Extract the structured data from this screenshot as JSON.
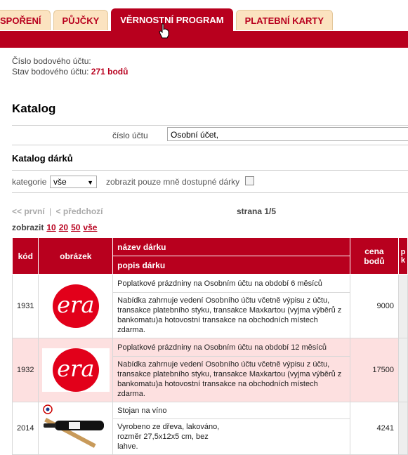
{
  "tabs": [
    "SPOŘENÍ",
    "PŮJČKY",
    "VĚRNOSTNÍ PROGRAM",
    "PLATEBNÍ KARTY"
  ],
  "account": {
    "number_label": "Číslo bodového účtu:",
    "balance_label": "Stav bodového účtu:",
    "balance_value": "271 bodů"
  },
  "catalog": {
    "title": "Katalog",
    "account_label": "číslo účtu",
    "account_value": "Osobní účet,",
    "gifts_title": "Katalog dárků",
    "category_label": "kategorie",
    "category_value": "vše",
    "only_available_label": "zobrazit pouze mně dostupné dárky"
  },
  "pager": {
    "first": "<< první",
    "sep": "|",
    "prev": "< předchozí",
    "page_info": "strana 1/5",
    "show_label": "zobrazit",
    "show_options": [
      "10",
      "20",
      "50",
      "vše"
    ]
  },
  "table": {
    "headers": {
      "code": "kód",
      "image": "obrázek",
      "name": "název dárku",
      "desc": "popis dárku",
      "price": "cena bodů",
      "extra": "p k"
    },
    "rows": [
      {
        "code": "1931",
        "logo_text": "era",
        "name": "Poplatkové prázdniny na Osobním účtu na období 6 měsíců",
        "desc": "Nabídka zahrnuje vedení Osobního účtu včetně výpisu z účtu, transakce platebního styku, transakce Maxkartou (vyjma výběrů z bankomatu)a hotovostní transakce na obchodních místech zdarma.",
        "price": "9000"
      },
      {
        "code": "1932",
        "logo_text": "era",
        "name": "Poplatkové prázdniny na Osobním účtu na období 12 měsíců",
        "desc": "Nabídka zahrnuje vedení Osobního účtu včetně výpisu z účtu, transakce platebního styku, transakce Maxkartou (vyjma výběrů z bankomatu)a hotovostní transakce na obchodních místech zdarma.",
        "price": "17500"
      },
      {
        "code": "2014",
        "name": "Stojan na víno",
        "desc": "Vyrobeno ze dřeva, lakováno, rozměr 27,5x12x5 cm, bez lahve.",
        "price": "4241"
      }
    ]
  },
  "colors": {
    "brand": "#b8001e",
    "tab_bg": "#fbe3c0",
    "era_red": "#e2001a"
  }
}
